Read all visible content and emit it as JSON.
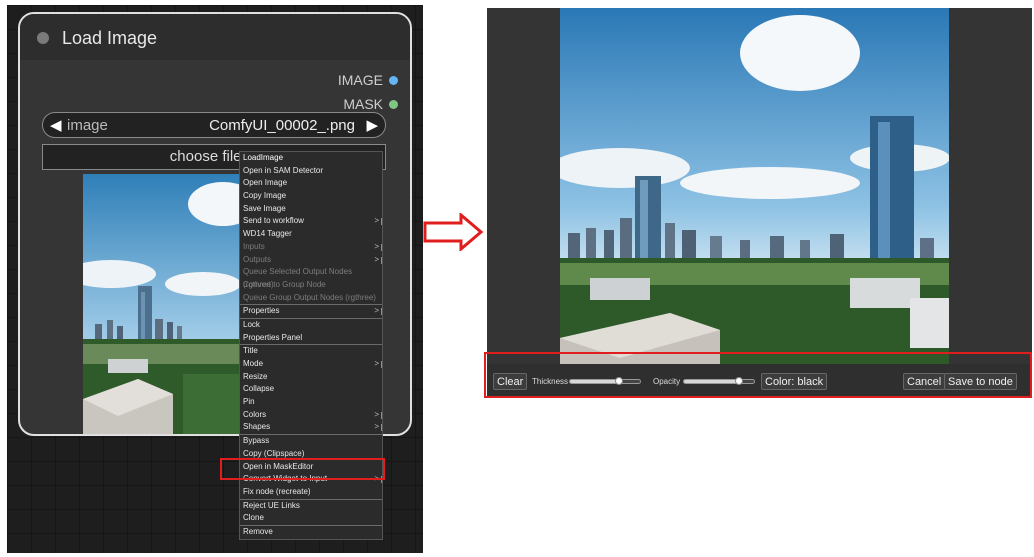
{
  "node": {
    "title": "Load Image",
    "outputs": [
      {
        "label": "IMAGE",
        "color": "#64b5f6"
      },
      {
        "label": "MASK",
        "color": "#81c784"
      }
    ],
    "image_widget": {
      "label": "image",
      "value": "ComfyUI_00002_.png",
      "left_arrow": "◀",
      "right_arrow": "▶"
    },
    "choose_file_label": "choose file to"
  },
  "context_menu": {
    "items": [
      {
        "label": "LoadImage",
        "kind": "title"
      },
      {
        "label": "Open in SAM Detector",
        "kind": "normal"
      },
      {
        "label": "Open Image",
        "kind": "normal"
      },
      {
        "label": "Copy Image",
        "kind": "normal"
      },
      {
        "label": "Save Image",
        "kind": "normal"
      },
      {
        "label": "Send to workflow",
        "kind": "normal",
        "submenu": true
      },
      {
        "label": "WD14 Tagger",
        "kind": "normal"
      },
      {
        "label": "Inputs",
        "kind": "disabled",
        "submenu": true
      },
      {
        "label": "Outputs",
        "kind": "disabled",
        "submenu": true
      },
      {
        "label": "Queue Selected Output Nodes (rgthree)",
        "kind": "disabled"
      },
      {
        "label": "Convert to Group Node",
        "kind": "disabled"
      },
      {
        "label": "Queue Group Output Nodes (rgthree)",
        "kind": "disabled"
      },
      {
        "kind": "separator"
      },
      {
        "label": "Properties",
        "kind": "normal",
        "submenu": true
      },
      {
        "kind": "separator"
      },
      {
        "label": "Lock",
        "kind": "normal"
      },
      {
        "label": "Properties Panel",
        "kind": "normal"
      },
      {
        "kind": "separator"
      },
      {
        "label": "Title",
        "kind": "normal"
      },
      {
        "label": "Mode",
        "kind": "normal",
        "submenu": true
      },
      {
        "label": "Resize",
        "kind": "normal"
      },
      {
        "label": "Collapse",
        "kind": "normal"
      },
      {
        "label": "Pin",
        "kind": "normal"
      },
      {
        "label": "Colors",
        "kind": "normal",
        "submenu": true
      },
      {
        "label": "Shapes",
        "kind": "normal",
        "submenu": true
      },
      {
        "kind": "separator"
      },
      {
        "label": "Bypass",
        "kind": "normal"
      },
      {
        "label": "Copy (Clipspace)",
        "kind": "normal"
      },
      {
        "label": "Open in MaskEditor",
        "kind": "normal",
        "highlight": true
      },
      {
        "label": "Convert Widget to Input",
        "kind": "normal",
        "submenu": true
      },
      {
        "label": "Fix node (recreate)",
        "kind": "normal"
      },
      {
        "kind": "separator"
      },
      {
        "label": "Reject UE Links",
        "kind": "normal"
      },
      {
        "label": "Clone",
        "kind": "normal"
      },
      {
        "kind": "separator"
      },
      {
        "label": "Remove",
        "kind": "normal"
      }
    ],
    "submenu_glyph": ">"
  },
  "mask_editor": {
    "clear_label": "Clear",
    "thickness_label": "Thickness",
    "thickness_level": 0.7,
    "opacity_label": "Opacity",
    "opacity_level": 0.78,
    "color_label": "Color: black",
    "cancel_label": "Cancel",
    "save_label": "Save to node"
  },
  "colors": {
    "highlight_border": "#e01e1e",
    "arrow": "#e01e1e"
  }
}
